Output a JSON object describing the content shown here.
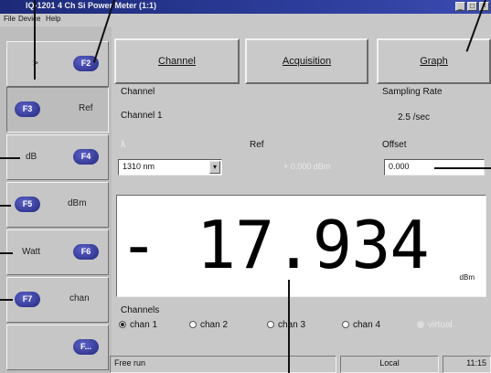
{
  "window": {
    "title": "IQ-1201 4 Ch Si Power Meter (1:1)",
    "min": "_",
    "max": "□",
    "close": "×"
  },
  "menu": [
    "File",
    "Device",
    "Help"
  ],
  "function_keys": [
    {
      "key": "F2",
      "label": ">"
    },
    {
      "key": "F3",
      "label": "Ref"
    },
    {
      "key": "F4",
      "label": "dB"
    },
    {
      "key": "F5",
      "label": "dBm"
    },
    {
      "key": "F6",
      "label": "Watt"
    },
    {
      "key": "F7",
      "label": "chan"
    },
    {
      "key": "F...",
      "label": ""
    }
  ],
  "tabs": {
    "channel": "Channel",
    "acquisition": "Acquisition",
    "graph": "Graph"
  },
  "channel": {
    "label": "Channel",
    "value": "Channel 1"
  },
  "sampling": {
    "label": "Sampling Rate",
    "value": "2.5 /sec"
  },
  "wavelength": {
    "label": "λ",
    "value": "1310 nm",
    "arrow": "▾"
  },
  "ref": {
    "label": "Ref",
    "value": "+ 0.000 dBm"
  },
  "offset": {
    "label": "Offset",
    "value": "0.000"
  },
  "readout": {
    "value": "- 17.934",
    "unit": "dBm"
  },
  "channels": {
    "label": "Channels",
    "options": [
      "chan 1",
      "chan 2",
      "chan 3",
      "chan 4",
      "virtual"
    ],
    "selected": "chan 1"
  },
  "status": {
    "run": "Free run",
    "mode": "Local",
    "time": "11:15"
  }
}
